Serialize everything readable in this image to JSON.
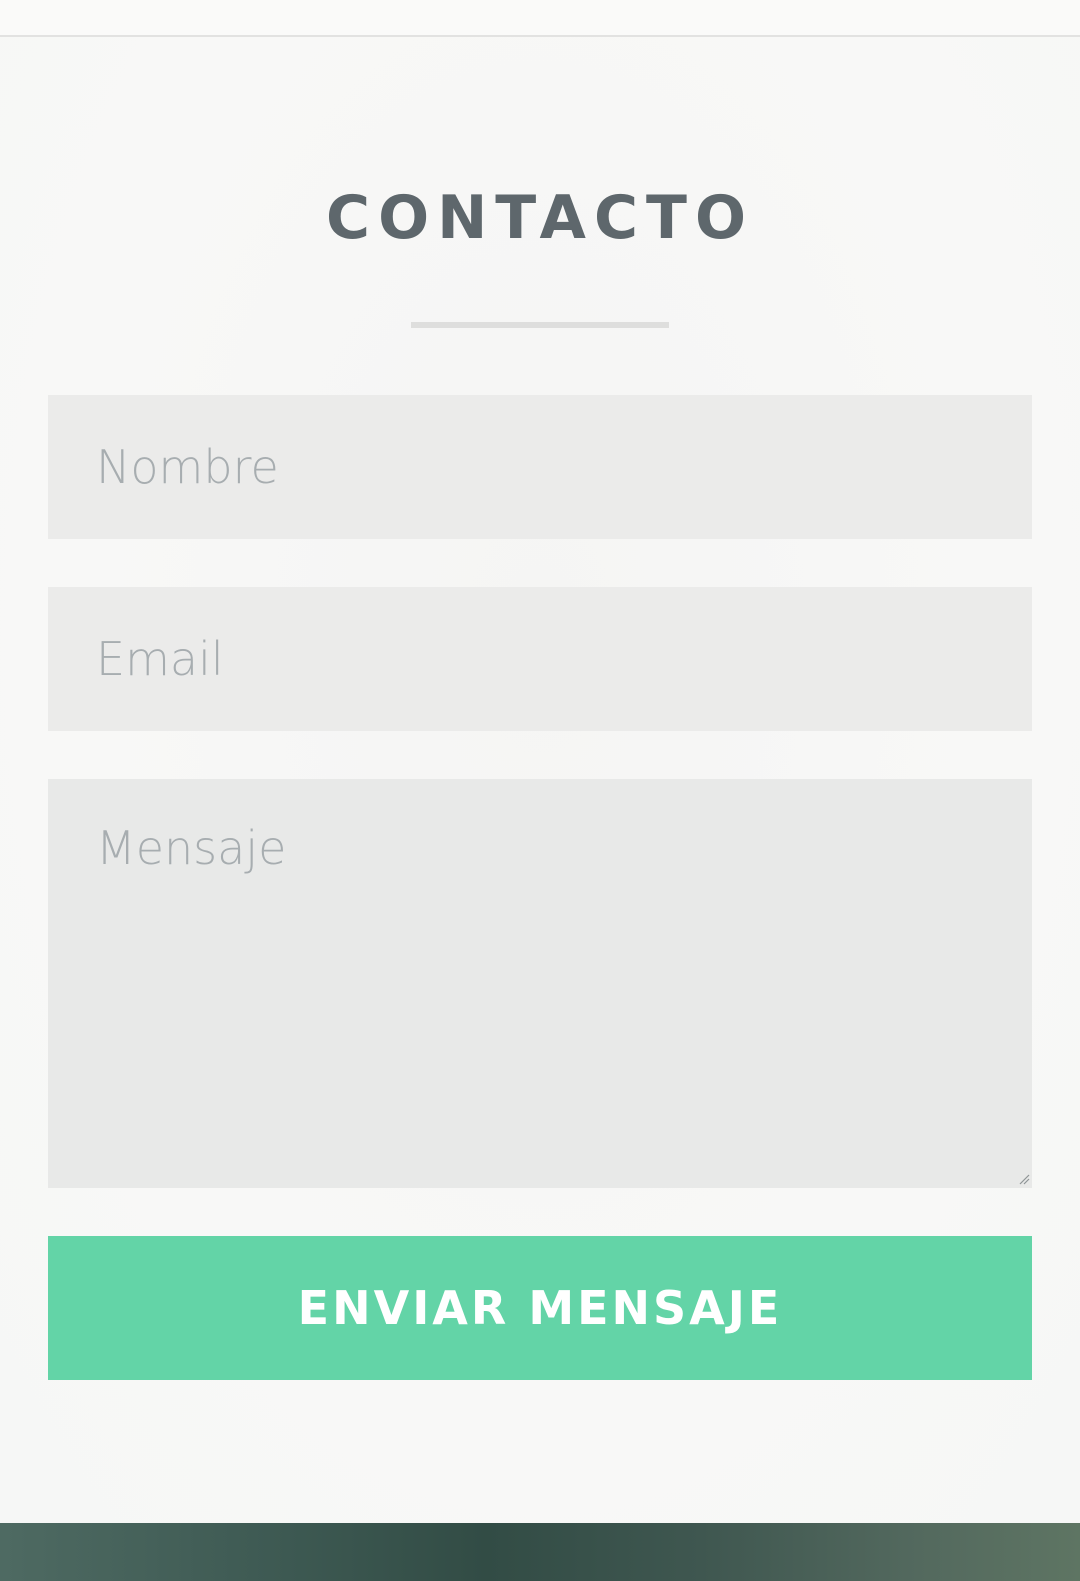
{
  "contact": {
    "title": "CONTACTO",
    "name_placeholder": "Nombre",
    "email_placeholder": "Email",
    "message_placeholder": "Mensaje",
    "submit_label": "ENVIAR MENSAJE"
  },
  "colors": {
    "accent": "#63d4a7",
    "title": "#5e676c",
    "field_bg": "#ebebea",
    "placeholder": "#a7adb0",
    "footer": "#3e5a53"
  }
}
